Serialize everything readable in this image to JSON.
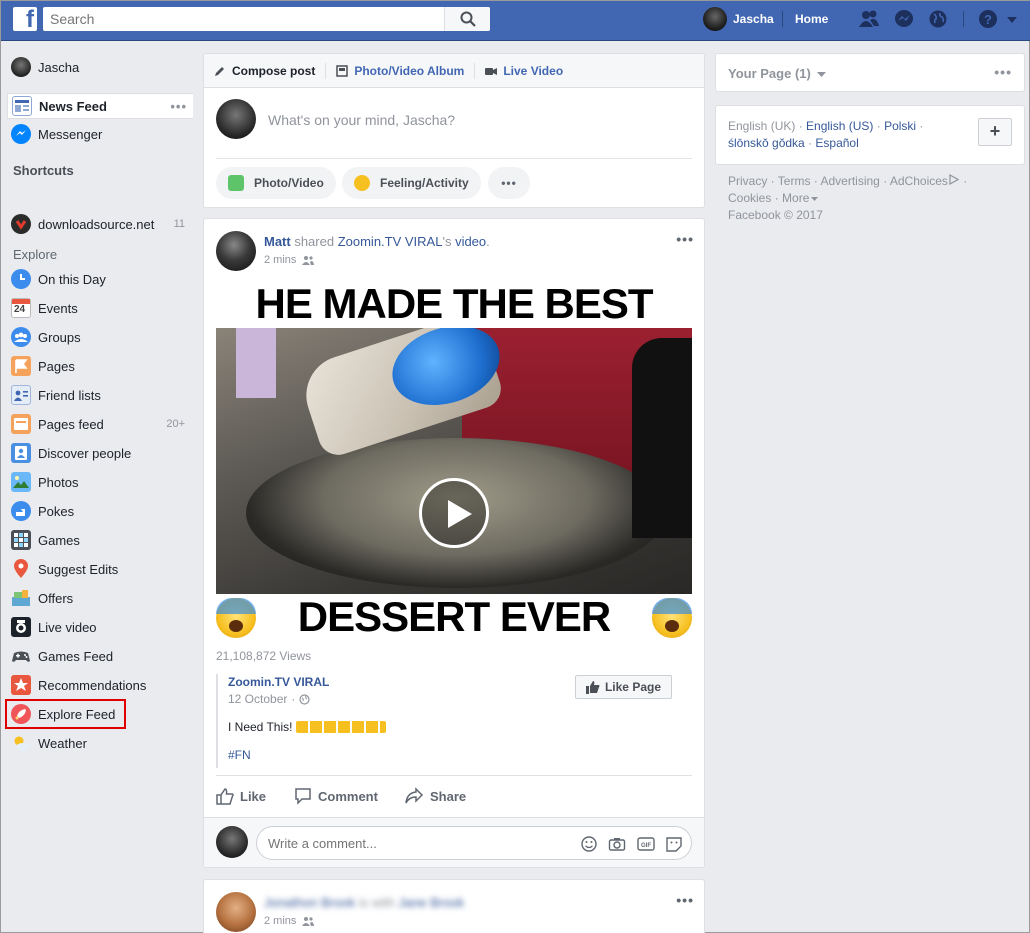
{
  "topbar": {
    "logo_letter": "f",
    "search_placeholder": "Search",
    "user_name": "Jascha",
    "home_label": "Home"
  },
  "leftnav": {
    "profile_name": "Jascha",
    "news_feed": "News Feed",
    "messenger": "Messenger",
    "shortcuts_heading": "Shortcuts",
    "shortcut_page": "downloadsource.net",
    "shortcut_count": "11",
    "explore_heading": "Explore",
    "items": [
      {
        "label": "On this Day"
      },
      {
        "label": "Events"
      },
      {
        "label": "Groups"
      },
      {
        "label": "Pages"
      },
      {
        "label": "Friend lists"
      },
      {
        "label": "Pages feed",
        "count": "20+"
      },
      {
        "label": "Discover people"
      },
      {
        "label": "Photos"
      },
      {
        "label": "Pokes"
      },
      {
        "label": "Games"
      },
      {
        "label": "Suggest Edits"
      },
      {
        "label": "Offers"
      },
      {
        "label": "Live video"
      },
      {
        "label": "Games Feed"
      },
      {
        "label": "Recommendations"
      },
      {
        "label": "Explore Feed"
      },
      {
        "label": "Weather"
      }
    ]
  },
  "composer": {
    "tab_compose": "Compose post",
    "tab_album": "Photo/Video Album",
    "tab_live": "Live Video",
    "prompt": "What's on your mind, Jascha?",
    "btn_photo": "Photo/Video",
    "btn_feeling": "Feeling/Activity"
  },
  "post": {
    "author": "Matt",
    "shared_word": " shared ",
    "page": "Zoomin.TV VIRAL",
    "possessive": "'s ",
    "object": "video",
    "period": ".",
    "time": "2 mins",
    "video_title_top": "HE MADE THE BEST",
    "video_title_bottom": "DESSERT EVER",
    "views": "21,108,872 Views",
    "shared_name": "Zoomin.TV VIRAL",
    "shared_date": "12 October",
    "shared_text": "I Need This!",
    "shared_tag": "#FN",
    "like_page": "Like Page",
    "like": "Like",
    "comment": "Comment",
    "share": "Share",
    "comment_placeholder": "Write a comment..."
  },
  "post2": {
    "author": "Jonathon Brook",
    "with_word": " is with ",
    "friend": "Jane Brook",
    "time": "2 mins"
  },
  "right": {
    "your_page": "Your Page (1)",
    "lang_current": "English (UK)",
    "lang_1": "English (US)",
    "lang_2": "Polski",
    "lang_3": "ślōnskŏ gŏdka",
    "lang_4": "Español",
    "plus": "+",
    "footer": {
      "privacy": "Privacy",
      "terms": "Terms",
      "advertising": "Advertising",
      "adchoices": "AdChoices",
      "cookies": "Cookies",
      "more": "More",
      "copyright": "Facebook © 2017"
    }
  },
  "colors": {
    "brand": "#4267b2",
    "link": "#365899",
    "highlight": "#e00000"
  }
}
